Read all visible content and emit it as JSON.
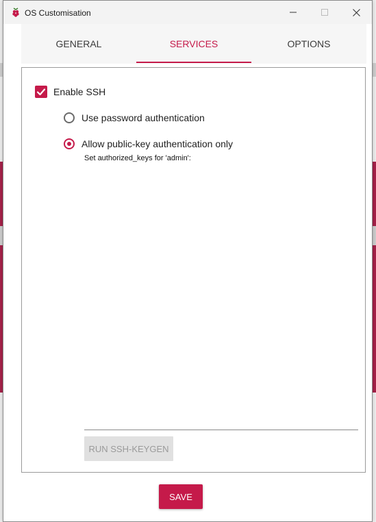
{
  "window": {
    "title": "OS Customisation",
    "controls": {
      "minimize": "minimize-icon",
      "maximize": "maximize-icon",
      "close": "close-icon"
    }
  },
  "tabs": [
    {
      "label": "GENERAL",
      "active": false
    },
    {
      "label": "SERVICES",
      "active": true
    },
    {
      "label": "OPTIONS",
      "active": false
    }
  ],
  "services": {
    "enable_ssh": {
      "label": "Enable SSH",
      "checked": true
    },
    "auth_options": [
      {
        "label": "Use password authentication",
        "selected": false
      },
      {
        "label": "Allow public-key authentication only",
        "selected": true
      }
    ],
    "authorized_keys_label": "Set authorized_keys for 'admin':",
    "authorized_keys_value": "",
    "keygen_button": {
      "label": "RUN SSH-KEYGEN",
      "enabled": false
    }
  },
  "footer": {
    "save_label": "SAVE"
  },
  "colors": {
    "accent": "#c51a4a",
    "disabled_button_bg": "#e0e0e0",
    "disabled_button_text": "#9a9a9a"
  }
}
